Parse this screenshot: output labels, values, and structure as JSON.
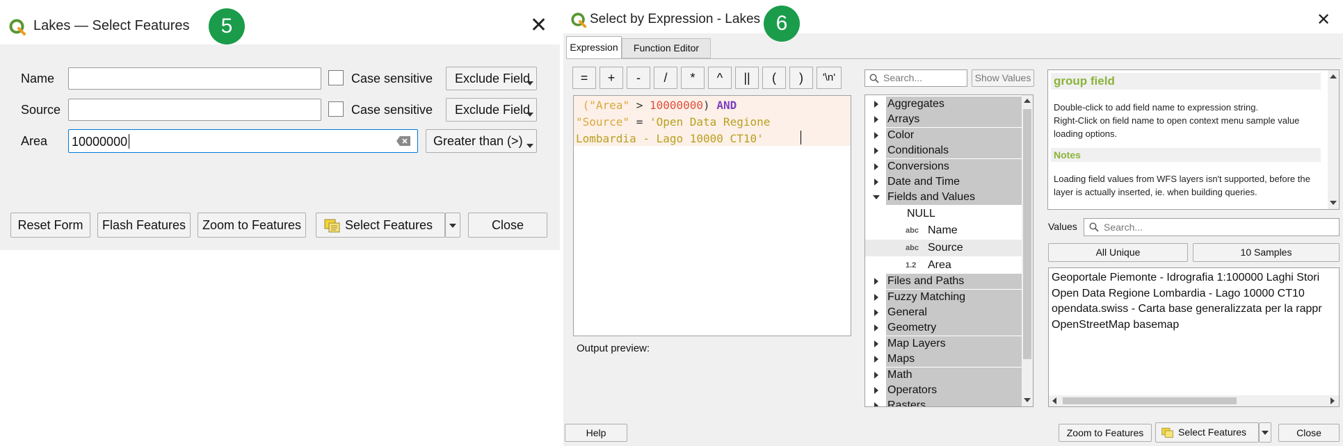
{
  "left_dialog": {
    "title": "Lakes — Select Features",
    "badge": "5",
    "rows": [
      {
        "label": "Name",
        "value": "",
        "case_label": "Case sensitive",
        "mode": "Exclude Field"
      },
      {
        "label": "Source",
        "value": "",
        "case_label": "Case sensitive",
        "mode": "Exclude Field"
      },
      {
        "label": "Area",
        "value": "10000000",
        "mode": "Greater than (>)"
      }
    ],
    "buttons": {
      "reset": "Reset Form",
      "flash": "Flash Features",
      "zoom": "Zoom to Features",
      "select": "Select Features",
      "close": "Close"
    }
  },
  "right_dialog": {
    "title": "Select by Expression - Lakes",
    "badge": "6",
    "tabs": [
      "Expression",
      "Function Editor"
    ],
    "operators": [
      "=",
      "+",
      "-",
      "/",
      "*",
      "^",
      "||",
      "(",
      ")",
      "'\\n'"
    ],
    "expression": {
      "line1_a": "(\"Area\"",
      "line1_b": " > ",
      "line1_c": "10000000",
      "line1_d": ") ",
      "line1_e": "AND",
      "line2_a": "\"Source\"",
      "line2_b": " = ",
      "line2_c": "'Open Data Regione",
      "line3_a": "Lombardia - Lago 10000 CT10'"
    },
    "output_preview_label": "Output preview:",
    "search_placeholder": "Search...",
    "show_values": "Show Values",
    "tree": [
      {
        "label": "Aggregates"
      },
      {
        "label": "Arrays"
      },
      {
        "label": "Color"
      },
      {
        "label": "Conditionals"
      },
      {
        "label": "Conversions"
      },
      {
        "label": "Date and Time"
      },
      {
        "label": "Fields and Values"
      },
      {
        "label": "Files and Paths"
      },
      {
        "label": "Fuzzy Matching"
      },
      {
        "label": "General"
      },
      {
        "label": "Geometry"
      },
      {
        "label": "Map Layers"
      },
      {
        "label": "Maps"
      },
      {
        "label": "Math"
      },
      {
        "label": "Operators"
      },
      {
        "label": "Rasters"
      }
    ],
    "fields": [
      {
        "type": "",
        "label": "NULL"
      },
      {
        "type": "abc",
        "label": "Name"
      },
      {
        "type": "abc",
        "label": "Source"
      },
      {
        "type": "1.2",
        "label": "Area"
      }
    ],
    "help": {
      "title": "group field",
      "text1": "Double-click to add field name to expression string.",
      "text2": "Right-Click on field name to open context menu sample value loading options.",
      "notes_title": "Notes",
      "notes_text": "Loading field values from WFS layers isn't supported, before the layer is actually inserted, ie. when building queries."
    },
    "values_label": "Values",
    "values_search_placeholder": "Search...",
    "all_unique": "All Unique",
    "ten_samples": "10 Samples",
    "values": [
      "Geoportale Piemonte - Idrografia 1:100000 Laghi Stori",
      "Open Data Regione Lombardia - Lago 10000 CT10",
      "opendata.swiss - Carta base generalizzata per la rappr",
      "OpenStreetMap basemap"
    ],
    "footer": {
      "help": "Help",
      "zoom": "Zoom to Features",
      "select": "Select Features",
      "close": "Close"
    }
  },
  "colors": {
    "badge": "#1a9c4b",
    "qgis_green": "#589632",
    "expr_bg": "#fdf0e8",
    "gray_tree": "#c8c8c8",
    "help_title": "#8bb33b"
  }
}
